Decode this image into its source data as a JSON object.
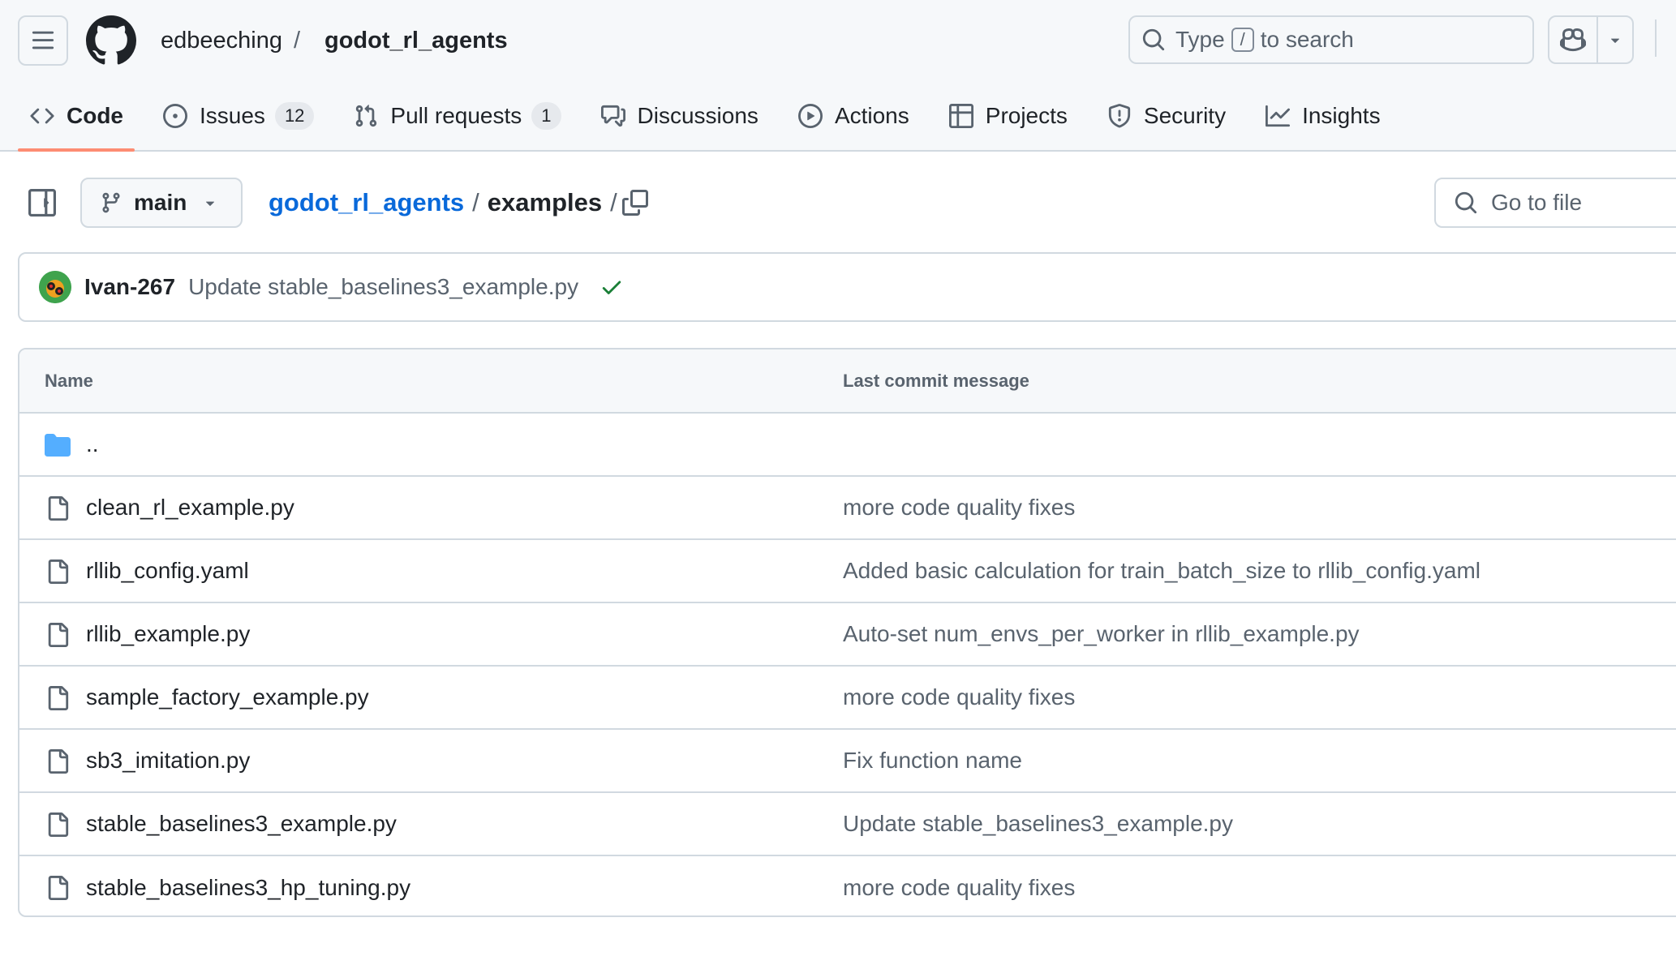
{
  "header": {
    "owner": "edbeeching",
    "separator": "/",
    "repo": "godot_rl_agents",
    "search": {
      "prefix": "Type",
      "key": "/",
      "suffix": "to search"
    }
  },
  "tabs": [
    {
      "label": "Code",
      "icon": "code-icon",
      "active": true
    },
    {
      "label": "Issues",
      "icon": "issue-opened-icon",
      "count": "12"
    },
    {
      "label": "Pull requests",
      "icon": "git-pull-request-icon",
      "count": "1"
    },
    {
      "label": "Discussions",
      "icon": "comment-discussion-icon"
    },
    {
      "label": "Actions",
      "icon": "play-icon"
    },
    {
      "label": "Projects",
      "icon": "table-icon"
    },
    {
      "label": "Security",
      "icon": "shield-icon"
    },
    {
      "label": "Insights",
      "icon": "graph-icon"
    }
  ],
  "branch": {
    "label": "main"
  },
  "path": {
    "repo": "godot_rl_agents",
    "sep": "/",
    "dir": "examples",
    "trail": "/"
  },
  "goto_file": {
    "placeholder": "Go to file"
  },
  "commit": {
    "author": "Ivan-267",
    "message": "Update stable_baselines3_example.py",
    "status": "success"
  },
  "table": {
    "headers": {
      "name": "Name",
      "message": "Last commit message"
    },
    "parent": "..",
    "files": [
      {
        "name": "clean_rl_example.py",
        "message": "more code quality fixes"
      },
      {
        "name": "rllib_config.yaml",
        "message": "Added basic calculation for train_batch_size to rllib_config.yaml"
      },
      {
        "name": "rllib_example.py",
        "message": "Auto-set num_envs_per_worker in rllib_example.py"
      },
      {
        "name": "sample_factory_example.py",
        "message": "more code quality fixes"
      },
      {
        "name": "sb3_imitation.py",
        "message": "Fix function name"
      },
      {
        "name": "stable_baselines3_example.py",
        "message": "Update stable_baselines3_example.py"
      },
      {
        "name": "stable_baselines3_hp_tuning.py",
        "message": "more code quality fixes"
      }
    ]
  },
  "colors": {
    "accent_underline": "#fd8c73",
    "link": "#0969da",
    "success": "#1a7f37",
    "folder": "#54aeff",
    "border": "#d1d9e0"
  }
}
